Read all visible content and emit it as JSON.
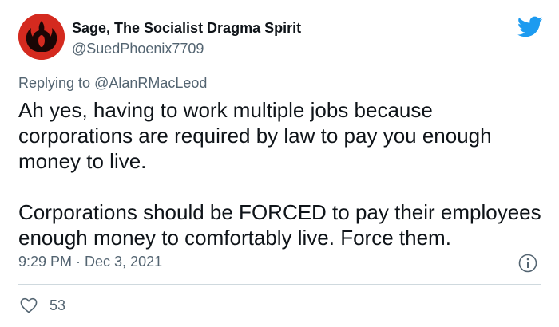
{
  "author": {
    "display_name": "Sage, The Socialist Dragma Spirit",
    "handle": "@SuedPhoenix7709",
    "avatar_icon": "rebel-alliance-icon"
  },
  "reply": {
    "prefix": "Replying to ",
    "target": "@AlanRMacLeod"
  },
  "tweet": {
    "paragraphs": [
      "Ah yes, having to work multiple jobs because corporations are required by law to pay you enough money to live.",
      "Corporations should be FORCED to pay their employees enough money to comfortably live. Force them."
    ],
    "timestamp": "9:29 PM · Dec 3, 2021"
  },
  "engagement": {
    "likes": "53"
  },
  "colors": {
    "brand_blue": "#1d9bf0",
    "avatar_red": "#d42a1f",
    "secondary_text": "#536471"
  },
  "icons": [
    "twitter-bird-icon",
    "info-icon",
    "heart-icon"
  ]
}
